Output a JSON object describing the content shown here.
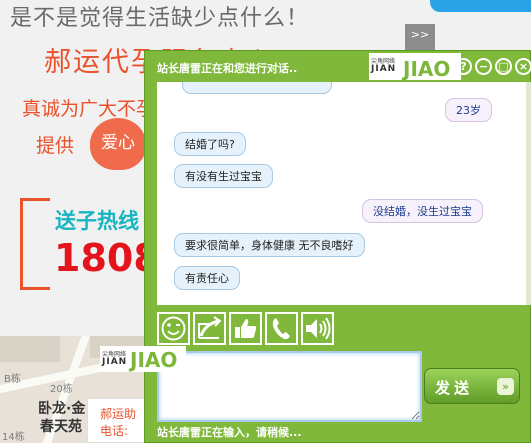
{
  "background": {
    "headline": "是不是觉得生活缺少点什么！",
    "subhead": "郝运代孕服务中心",
    "line3": "真诚为广大不孕",
    "line4": "提供",
    "heart_text": "爱心",
    "promo": "送子热线",
    "phone": "1808",
    "collapse_label": ">>",
    "map": {
      "labels": [
        "B栋",
        "20栋",
        "14栋"
      ],
      "place_line1": "卧龙·金",
      "place_line2": "春天苑",
      "ad_line1": "郝运助",
      "ad_line2": "电话:"
    }
  },
  "chat": {
    "title": "站长唐雷正在和您进行对话..",
    "logo_small": "尖角网络",
    "logo_main": "JIAN",
    "logo_big": "JIAO",
    "window_buttons": [
      "?",
      "−",
      "□",
      "×"
    ],
    "messages": [
      {
        "side": "out",
        "text": "23岁"
      },
      {
        "side": "in",
        "text": "结婚了吗?"
      },
      {
        "side": "in",
        "text": "有没有生过宝宝"
      },
      {
        "side": "out",
        "text": "没结婚，没生过宝宝"
      },
      {
        "side": "in",
        "text": "要求很简单，身体健康 无不良嗜好"
      },
      {
        "side": "in",
        "text": "有责任心"
      }
    ],
    "toolbar_icons": [
      "emoji-icon",
      "share-icon",
      "thumbs-up-icon",
      "phone-icon",
      "volume-icon"
    ],
    "input_value": "",
    "send_label": "发送",
    "status": "站长唐雷正在输入，请稍候..."
  }
}
